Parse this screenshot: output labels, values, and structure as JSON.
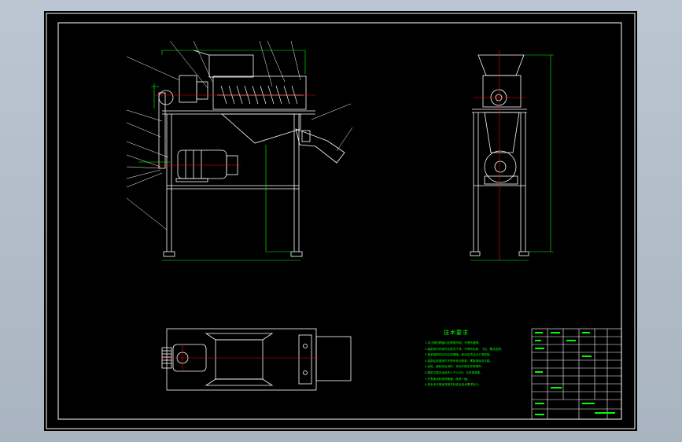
{
  "technical_requirements": {
    "title": "技术要求",
    "items": [
      "1.未注明的焊缝均应焊接牢固，不得有漏焊。",
      "2.装配前所有零件应清洗干净，不得有毛刺、飞边、氧化皮等。",
      "3.轴承装配时应加注润滑脂，转动应灵活无卡滞现象。",
      "4.装配后各紧固件不得有松动现象，螺旋轴转动平稳。",
      "5.齿轮、链轮啮合良好，传动平稳无异常噪声。",
      "6.整机空载试运转不少于2小时，无异常现象。",
      "7.外表面涂防锈漆两遍、面漆一遍。",
      "8.其余未尽事宜按相关标准及技术要求执行。"
    ]
  },
  "colors": {
    "workspace": "#b9c3cf",
    "sheet": "#000000",
    "outline": "#ffffff",
    "dimension": "#00ff00",
    "centerline": "#ff0000"
  },
  "icons": {
    "screw_shaft": "helical-screw-icon",
    "motor": "electric-motor-icon",
    "pulley": "pulley-icon"
  }
}
